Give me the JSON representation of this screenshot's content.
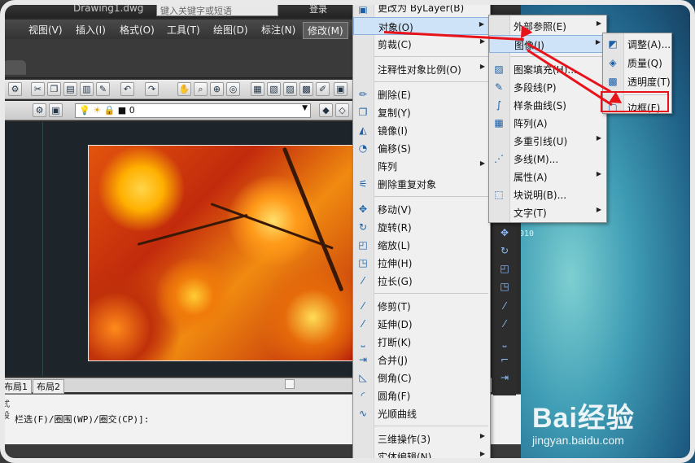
{
  "titlebar": {
    "doc_title": "Drawing1.dwg",
    "search_placeholder": "键入关键字或短语",
    "login": "登录"
  },
  "menubar": {
    "items": [
      "视图(V)",
      "插入(I)",
      "格式(O)",
      "工具(T)",
      "绘图(D)",
      "标注(N)",
      "修改(M)"
    ],
    "active": "修改(M)"
  },
  "toolbar2": {
    "layer_value": "0"
  },
  "layout_tabs": [
    "布局1",
    "布局2"
  ],
  "command_line": {
    "left_labels": [
      "式",
      "设"
    ],
    "text": "栏选(F)/圈围(WP)/圈交(CP)]:"
  },
  "modify_menu": {
    "top_partial": "更改为 ByLayer(B)",
    "items": [
      {
        "label": "对象(O)",
        "icon": "object-icon",
        "arrow": true,
        "highlight": true
      },
      {
        "label": "剪裁(C)",
        "icon": "",
        "arrow": true
      },
      {
        "label": "注释性对象比例(O)",
        "icon": "",
        "arrow": true
      },
      {
        "label": "删除(E)",
        "icon": "eraser-icon"
      },
      {
        "label": "复制(Y)",
        "icon": "copy-icon"
      },
      {
        "label": "镜像(I)",
        "icon": "mirror-icon"
      },
      {
        "label": "偏移(S)",
        "icon": "offset-icon"
      },
      {
        "label": "阵列",
        "icon": "",
        "arrow": true
      },
      {
        "label": "删除重复对象",
        "icon": "overkill-icon"
      },
      {
        "label": "移动(V)",
        "icon": "move-icon"
      },
      {
        "label": "旋转(R)",
        "icon": "rotate-icon"
      },
      {
        "label": "缩放(L)",
        "icon": "scale-icon"
      },
      {
        "label": "拉伸(H)",
        "icon": "stretch-icon"
      },
      {
        "label": "拉长(G)",
        "icon": "lengthen-icon"
      },
      {
        "label": "修剪(T)",
        "icon": "trim-icon"
      },
      {
        "label": "延伸(D)",
        "icon": "extend-icon"
      },
      {
        "label": "打断(K)",
        "icon": "break-icon"
      },
      {
        "label": "合并(J)",
        "icon": "join-icon"
      },
      {
        "label": "倒角(C)",
        "icon": "chamfer-icon"
      },
      {
        "label": "圆角(F)",
        "icon": "fillet-icon"
      },
      {
        "label": "光顺曲线",
        "icon": "blend-icon"
      },
      {
        "label": "三维操作(3)",
        "icon": "",
        "arrow": true
      },
      {
        "label": "实体编辑(N)",
        "icon": "",
        "arrow": true
      }
    ]
  },
  "object_submenu": {
    "items": [
      {
        "label": "外部参照(E)",
        "arrow": true
      },
      {
        "label": "图像(I)",
        "arrow": true,
        "highlight": true
      },
      {
        "label": "图案填充(H)...",
        "icon": "hatch-icon"
      },
      {
        "label": "多段线(P)",
        "icon": "polyline-icon"
      },
      {
        "label": "样条曲线(S)",
        "icon": "spline-icon"
      },
      {
        "label": "阵列(A)",
        "icon": "array-icon"
      },
      {
        "label": "多重引线(U)",
        "arrow": true
      },
      {
        "label": "多线(M)...",
        "icon": "mline-icon"
      },
      {
        "label": "属性(A)",
        "arrow": true
      },
      {
        "label": "块说明(B)...",
        "icon": "block-icon"
      },
      {
        "label": "文字(T)",
        "arrow": true
      }
    ]
  },
  "image_submenu": {
    "items": [
      {
        "label": "调整(A)...",
        "icon": "adjust-icon"
      },
      {
        "label": "质量(Q)",
        "icon": "quality-icon"
      },
      {
        "label": "透明度(T)",
        "icon": "transparency-icon"
      },
      {
        "label": "边框(F)",
        "icon": "frame-icon",
        "boxed": true
      }
    ]
  },
  "desktop": {
    "label": "010"
  },
  "watermark": {
    "brand": "Bai经验",
    "url": "jingyan.baidu.com"
  },
  "colors": {
    "highlight": "#cfe3f8",
    "annotation_red": "#e8121a"
  }
}
